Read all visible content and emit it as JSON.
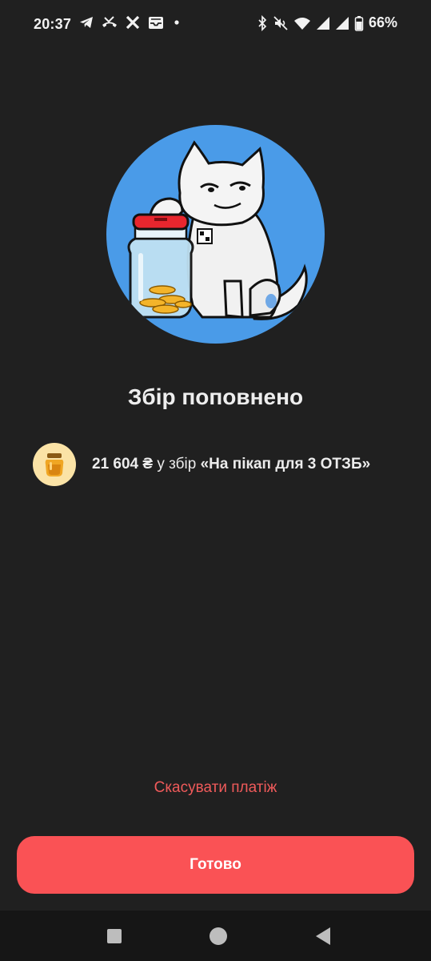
{
  "status_bar": {
    "time": "20:37",
    "left_icons": [
      "telegram-icon",
      "missed-call-icon",
      "x-icon",
      "inbox-icon",
      "notification-dot-icon"
    ],
    "right_icons": [
      "bluetooth-icon",
      "mute-icon",
      "wifi-icon",
      "signal-icon",
      "signal-icon",
      "battery-icon"
    ],
    "battery": "66%"
  },
  "illustration": {
    "name": "cat-with-jar-icon",
    "circle_color": "#4a9be8"
  },
  "title": "Збір поповнено",
  "summary": {
    "icon": "honey-jar-icon",
    "amount": "21 604 ₴",
    "preposition": " у збір ",
    "jar_name": "«На пікап для 3 ОТЗБ»"
  },
  "actions": {
    "cancel_label": "Скасувати платіж",
    "done_label": "Готово"
  },
  "colors": {
    "background": "#202020",
    "accent": "#fa5255",
    "cancel_text": "#ef5a5a"
  },
  "nav_bar": {
    "buttons": [
      "recents-square-icon",
      "home-circle-icon",
      "back-triangle-icon"
    ]
  }
}
